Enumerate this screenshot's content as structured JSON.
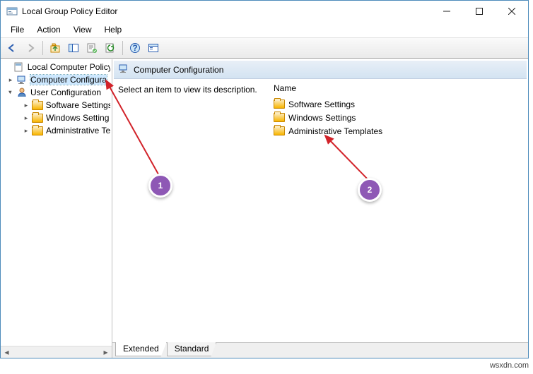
{
  "window": {
    "title": "Local Group Policy Editor"
  },
  "menu": {
    "file": "File",
    "action": "Action",
    "view": "View",
    "help": "Help"
  },
  "tree": {
    "root": "Local Computer Policy",
    "computer": "Computer Configura",
    "user": "User Configuration",
    "software": "Software Settings",
    "windows": "Windows Setting",
    "admin": "Administrative Te"
  },
  "header": {
    "title": "Computer Configuration"
  },
  "description": {
    "text": "Select an item to view its description."
  },
  "list": {
    "colname": "Name",
    "items": {
      "software": "Software Settings",
      "windows": "Windows Settings",
      "admin": "Administrative Templates"
    }
  },
  "tabs": {
    "extended": "Extended",
    "standard": "Standard"
  },
  "annotations": {
    "one": "1",
    "two": "2"
  },
  "watermark": "wsxdn.com"
}
